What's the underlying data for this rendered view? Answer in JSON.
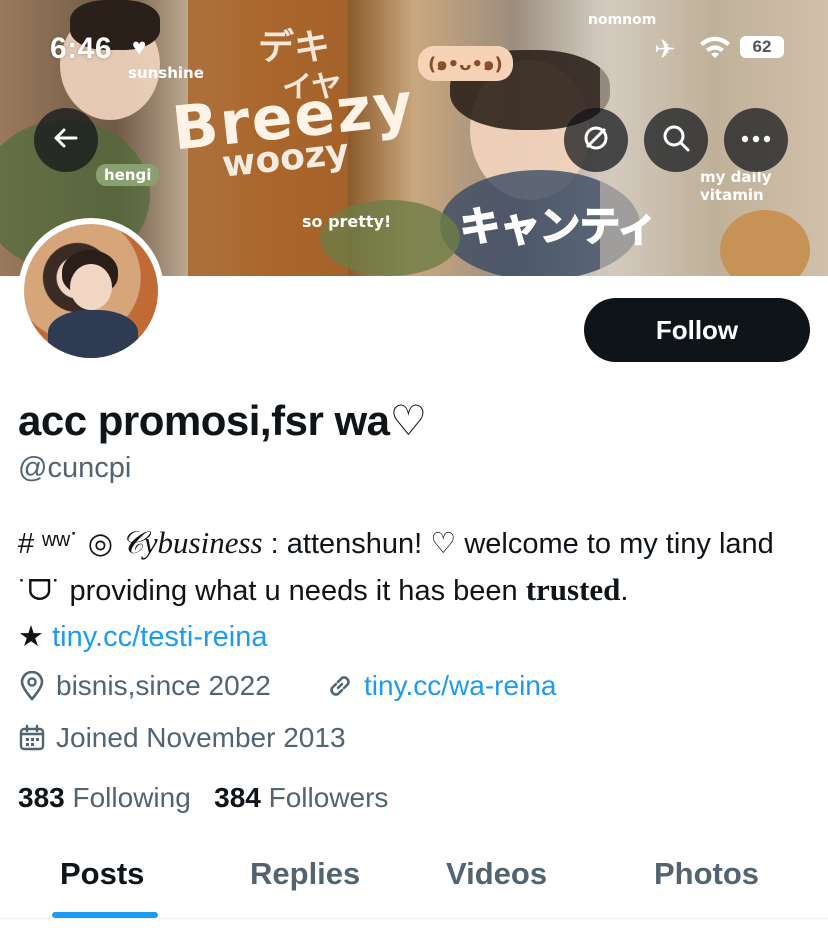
{
  "status_bar": {
    "time": "6:46",
    "battery": "62"
  },
  "banner": {
    "texts": [
      "Breezy",
      "woozy",
      "キャンティ",
      "デキ",
      "イヤ",
      "(๑•ᴗ•๑)",
      "sunshine",
      "hengi",
      "so pretty!",
      "my daily vitamin",
      "nomnom"
    ]
  },
  "nav": {
    "back_icon": "back-arrow-icon",
    "translate_icon": "translate-icon",
    "search_icon": "search-icon",
    "more_icon": "more-icon"
  },
  "profile": {
    "display_name": "acc promosi,fsr wa♡",
    "handle": "@cuncpi",
    "follow_label": "Follow",
    "bio": {
      "prefix": "# ʷʷ˙ ◎ ",
      "brand": "𝒞ybusiness",
      "after_brand": " : attenshun! ♡ welcome to my tiny land ˙ᗜ˙ providing what u needs it has been ",
      "trusted": "trusted",
      "end": ".",
      "star": "★ ",
      "link": "tiny.cc/testi-reina"
    },
    "location": "bisnis,since 2022",
    "website": "tiny.cc/wa-reina",
    "joined": "Joined November 2013",
    "following_count": "383",
    "following_label": "Following",
    "followers_count": "384",
    "followers_label": "Followers"
  },
  "tabs": [
    {
      "label": "Posts"
    },
    {
      "label": "Replies"
    },
    {
      "label": "Videos"
    },
    {
      "label": "Photos"
    }
  ],
  "colors": {
    "accent": "#1d9bf0",
    "text": "#0f1419",
    "muted": "#536471"
  }
}
